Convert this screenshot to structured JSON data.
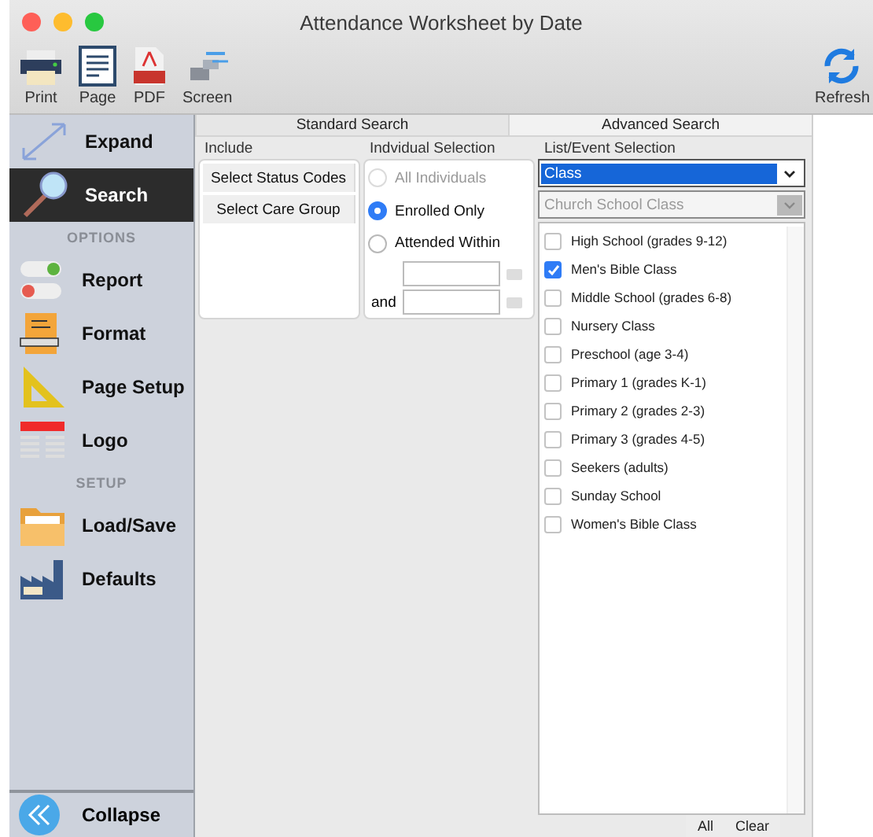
{
  "window": {
    "title": "Attendance Worksheet by Date"
  },
  "toolbar": [
    {
      "label": "Print"
    },
    {
      "label": "Page"
    },
    {
      "label": "PDF"
    },
    {
      "label": "Screen"
    }
  ],
  "refresh": {
    "label": "Refresh"
  },
  "sidebar": {
    "items": [
      {
        "kind": "item",
        "label": "Expand",
        "selected": false
      },
      {
        "kind": "item",
        "label": "Search",
        "selected": true
      },
      {
        "kind": "section",
        "label": "OPTIONS"
      },
      {
        "kind": "item",
        "label": "Report",
        "selected": false
      },
      {
        "kind": "item",
        "label": "Format",
        "selected": false
      },
      {
        "kind": "item",
        "label": "Page Setup",
        "selected": false
      },
      {
        "kind": "item",
        "label": "Logo",
        "selected": false
      },
      {
        "kind": "section",
        "label": "SETUP"
      },
      {
        "kind": "item",
        "label": "Load/Save",
        "selected": false
      },
      {
        "kind": "item",
        "label": "Defaults",
        "selected": false
      }
    ],
    "collapse": {
      "label": "Collapse"
    }
  },
  "tabs": [
    {
      "label": "Standard Search",
      "selected": false
    },
    {
      "label": "Advanced Search",
      "selected": true
    }
  ],
  "include": {
    "heading": "Include",
    "buttons": [
      "Select Status Codes",
      "Select Care Group"
    ]
  },
  "individual": {
    "heading": "Indvidual Selection",
    "options": [
      {
        "label": "All Individuals",
        "selected": false,
        "disabled": true
      },
      {
        "label": "Enrolled Only",
        "selected": true,
        "disabled": false
      },
      {
        "label": "Attended Within",
        "selected": false,
        "disabled": false
      }
    ],
    "and_label": "and"
  },
  "list_selection": {
    "heading": "List/Event Selection",
    "type_select": {
      "value": "Class"
    },
    "subtype_select": {
      "value": "Church School Class",
      "disabled": true
    },
    "items": [
      {
        "label": "High School (grades 9-12)",
        "checked": false
      },
      {
        "label": "Men's Bible Class",
        "checked": true
      },
      {
        "label": "Middle School (grades 6-8)",
        "checked": false
      },
      {
        "label": "Nursery Class",
        "checked": false
      },
      {
        "label": "Preschool (age 3-4)",
        "checked": false
      },
      {
        "label": "Primary 1 (grades K-1)",
        "checked": false
      },
      {
        "label": "Primary 2 (grades 2-3)",
        "checked": false
      },
      {
        "label": "Primary 3 (grades 4-5)",
        "checked": false
      },
      {
        "label": "Seekers (adults)",
        "checked": false
      },
      {
        "label": "Sunday School",
        "checked": false
      },
      {
        "label": "Women's Bible Class",
        "checked": false
      }
    ],
    "buttons": [
      "All",
      "Clear"
    ]
  }
}
